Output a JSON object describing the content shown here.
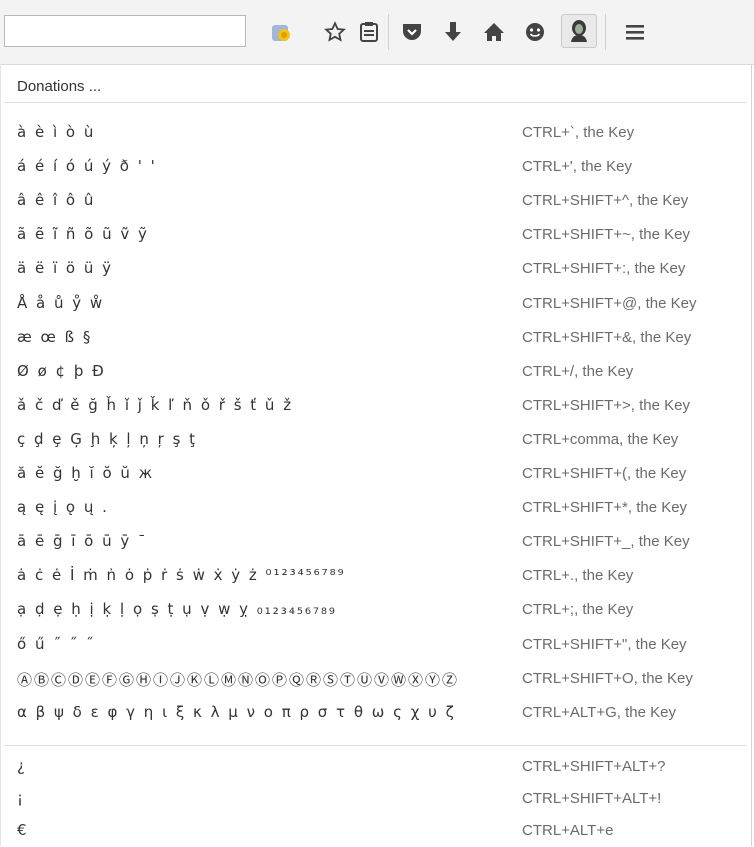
{
  "toolbar": {
    "url_value": "",
    "icons": [
      "extension-icon",
      "star-icon",
      "reading-list-icon",
      "pocket-icon",
      "download-icon",
      "home-icon",
      "chat-icon",
      "persona-icon",
      "menu-icon"
    ]
  },
  "menu": {
    "donations_label": "Donations ...",
    "items": [
      {
        "chars": "à è ì ò ù",
        "shortcut": "CTRL+`, the Key"
      },
      {
        "chars": "á é í ó ú ý ð ' '",
        "shortcut": "CTRL+', the Key"
      },
      {
        "chars": "â ê î ô û",
        "shortcut": "CTRL+SHIFT+^, the Key"
      },
      {
        "chars": "ã ẽ ĩ ñ õ ũ ṽ ỹ",
        "shortcut": "CTRL+SHIFT+~, the Key"
      },
      {
        "chars": "ä ë ï ö ü ÿ",
        "shortcut": "CTRL+SHIFT+:, the Key"
      },
      {
        "chars": "Å å ů ẙ ẘ",
        "shortcut": "CTRL+SHIFT+@, the Key"
      },
      {
        "chars": "æ œ ß §",
        "shortcut": "CTRL+SHIFT+&, the Key"
      },
      {
        "chars": "Ø ø ¢ þ Đ",
        "shortcut": "CTRL+/, the Key"
      },
      {
        "chars": "ǎ č ď ě ğ ȟ ǐ ǰ ǩ ľ ň ǒ ř š ť ǔ ž",
        "shortcut": "CTRL+SHIFT+>, the Key"
      },
      {
        "chars": "ç ḑ ȩ Ģ ḩ ķ ļ ņ ŗ ş ţ",
        "shortcut": "CTRL+comma, the Key"
      },
      {
        "chars": "ă ĕ ğ ḫ ĭ ŏ ŭ ж",
        "shortcut": "CTRL+SHIFT+(, the Key"
      },
      {
        "chars": "ą ę į ǫ ų .",
        "shortcut": "CTRL+SHIFT+*, the Key"
      },
      {
        "chars": "ā ē ḡ ī ō ū ȳ ¯",
        "shortcut": "CTRL+SHIFT+_, the Key"
      },
      {
        "chars": "ȧ ċ ė İ ṁ ṅ ȯ ṗ ṙ ṡ ẇ ẋ ẏ ż ⁰¹²³⁴⁵⁶⁷⁸⁹",
        "shortcut": "CTRL+., the Key"
      },
      {
        "chars": "ạ ḍ ẹ ḥ ị ḳ ḷ ọ ṣ ṭ ụ ṿ ẉ ỵ ₀₁₂₃₄₅₆₇₈₉",
        "shortcut": "CTRL+;, the Key"
      },
      {
        "chars": "ő ű ˝ ˝ ˝",
        "shortcut": "CTRL+SHIFT+\", the Key"
      },
      {
        "chars": "ⒶⒷⒸⒹⒺⒻⒼⒽⒾⒿⓀⓁⓂⓃⓄⓅⓆⓇⓈⓉⓊⓋⓌⓍⓎⓏ",
        "shortcut": "CTRL+SHIFT+O, the Key"
      },
      {
        "chars": "α β ψ δ ε φ γ η ι ξ κ λ μ ν ο π ρ σ τ θ ω ς χ υ ζ",
        "shortcut": "CTRL+ALT+G, the Key"
      }
    ],
    "extra_items": [
      {
        "chars": "¿",
        "shortcut": "CTRL+SHIFT+ALT+?"
      },
      {
        "chars": "¡",
        "shortcut": "CTRL+SHIFT+ALT+!"
      },
      {
        "chars": "€",
        "shortcut": "CTRL+ALT+e"
      }
    ]
  }
}
